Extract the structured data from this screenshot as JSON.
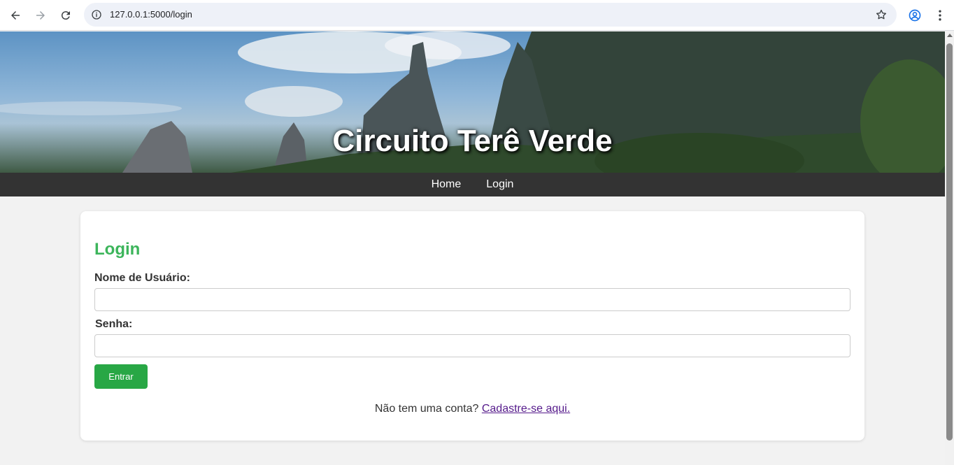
{
  "browser": {
    "url": "127.0.0.1:5000/login"
  },
  "header": {
    "title": "Circuito Terê Verde"
  },
  "nav": {
    "items": [
      {
        "label": "Home"
      },
      {
        "label": "Login"
      }
    ]
  },
  "login": {
    "heading": "Login",
    "username_label": "Nome de Usuário:",
    "username_value": "",
    "password_label": "Senha:",
    "password_value": "",
    "submit_label": "Entrar",
    "signup_prompt": "Não tem uma conta?",
    "signup_link": "Cadastre-se aqui."
  },
  "colors": {
    "accent_green": "#3cb55b",
    "button_green": "#28a745",
    "nav_bg": "#333333",
    "visited_link": "#551a8b"
  }
}
